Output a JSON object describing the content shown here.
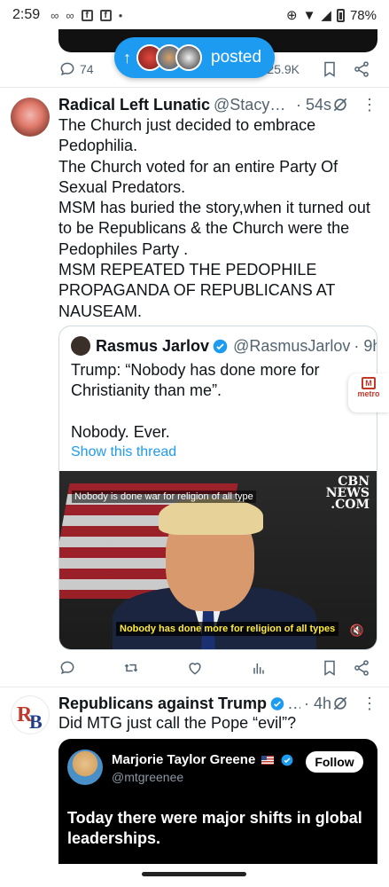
{
  "status_bar": {
    "time": "2:59",
    "battery": "78%"
  },
  "colors": {
    "accent": "#1d9bf0",
    "text": "#0f1419",
    "muted": "#536471",
    "verified": "#1d9bf0"
  },
  "new_posts_pill": {
    "label": "posted"
  },
  "prev_tweet": {
    "replies": "74",
    "views": "25.9K"
  },
  "tweet1": {
    "name": "Radical Left Lunatic",
    "handle": "@StacyM...",
    "time": "· 54s",
    "lines": [
      "The Church just decided to embrace Pedophilia.",
      "The Church voted for an entire Party Of Sexual Predators.",
      "MSM has buried the story,when it turned out to be Republicans & the Church were the Pedophiles Party .",
      "MSM REPEATED THE PEDOPHILE PROPAGANDA OF REPUBLICANS AT NAUSEAM."
    ],
    "quote": {
      "name": "Rasmus Jarlov",
      "handle": "@RasmusJarlov",
      "time": "· 9h",
      "text1": "Trump: “Nobody has done more for Christianity than me”.",
      "text2": "Nobody. Ever.",
      "link": "Show this thread",
      "video": {
        "top_caption": "Nobody is done war for religion of all type",
        "logo": "CBN NEWS .COM",
        "subtitle": "Nobody has done more for religion of all types"
      }
    }
  },
  "metro_badge": {
    "label": "metro"
  },
  "tweet2": {
    "name": "Republicans against Trump",
    "time": "· 4h",
    "text": "Did MTG just call the Pope “evil”?",
    "embed": {
      "name": "Marjorie Taylor Greene",
      "handle": "@mtgreenee",
      "follow": "Follow",
      "text": "Today there were major shifts in global leaderships."
    }
  }
}
